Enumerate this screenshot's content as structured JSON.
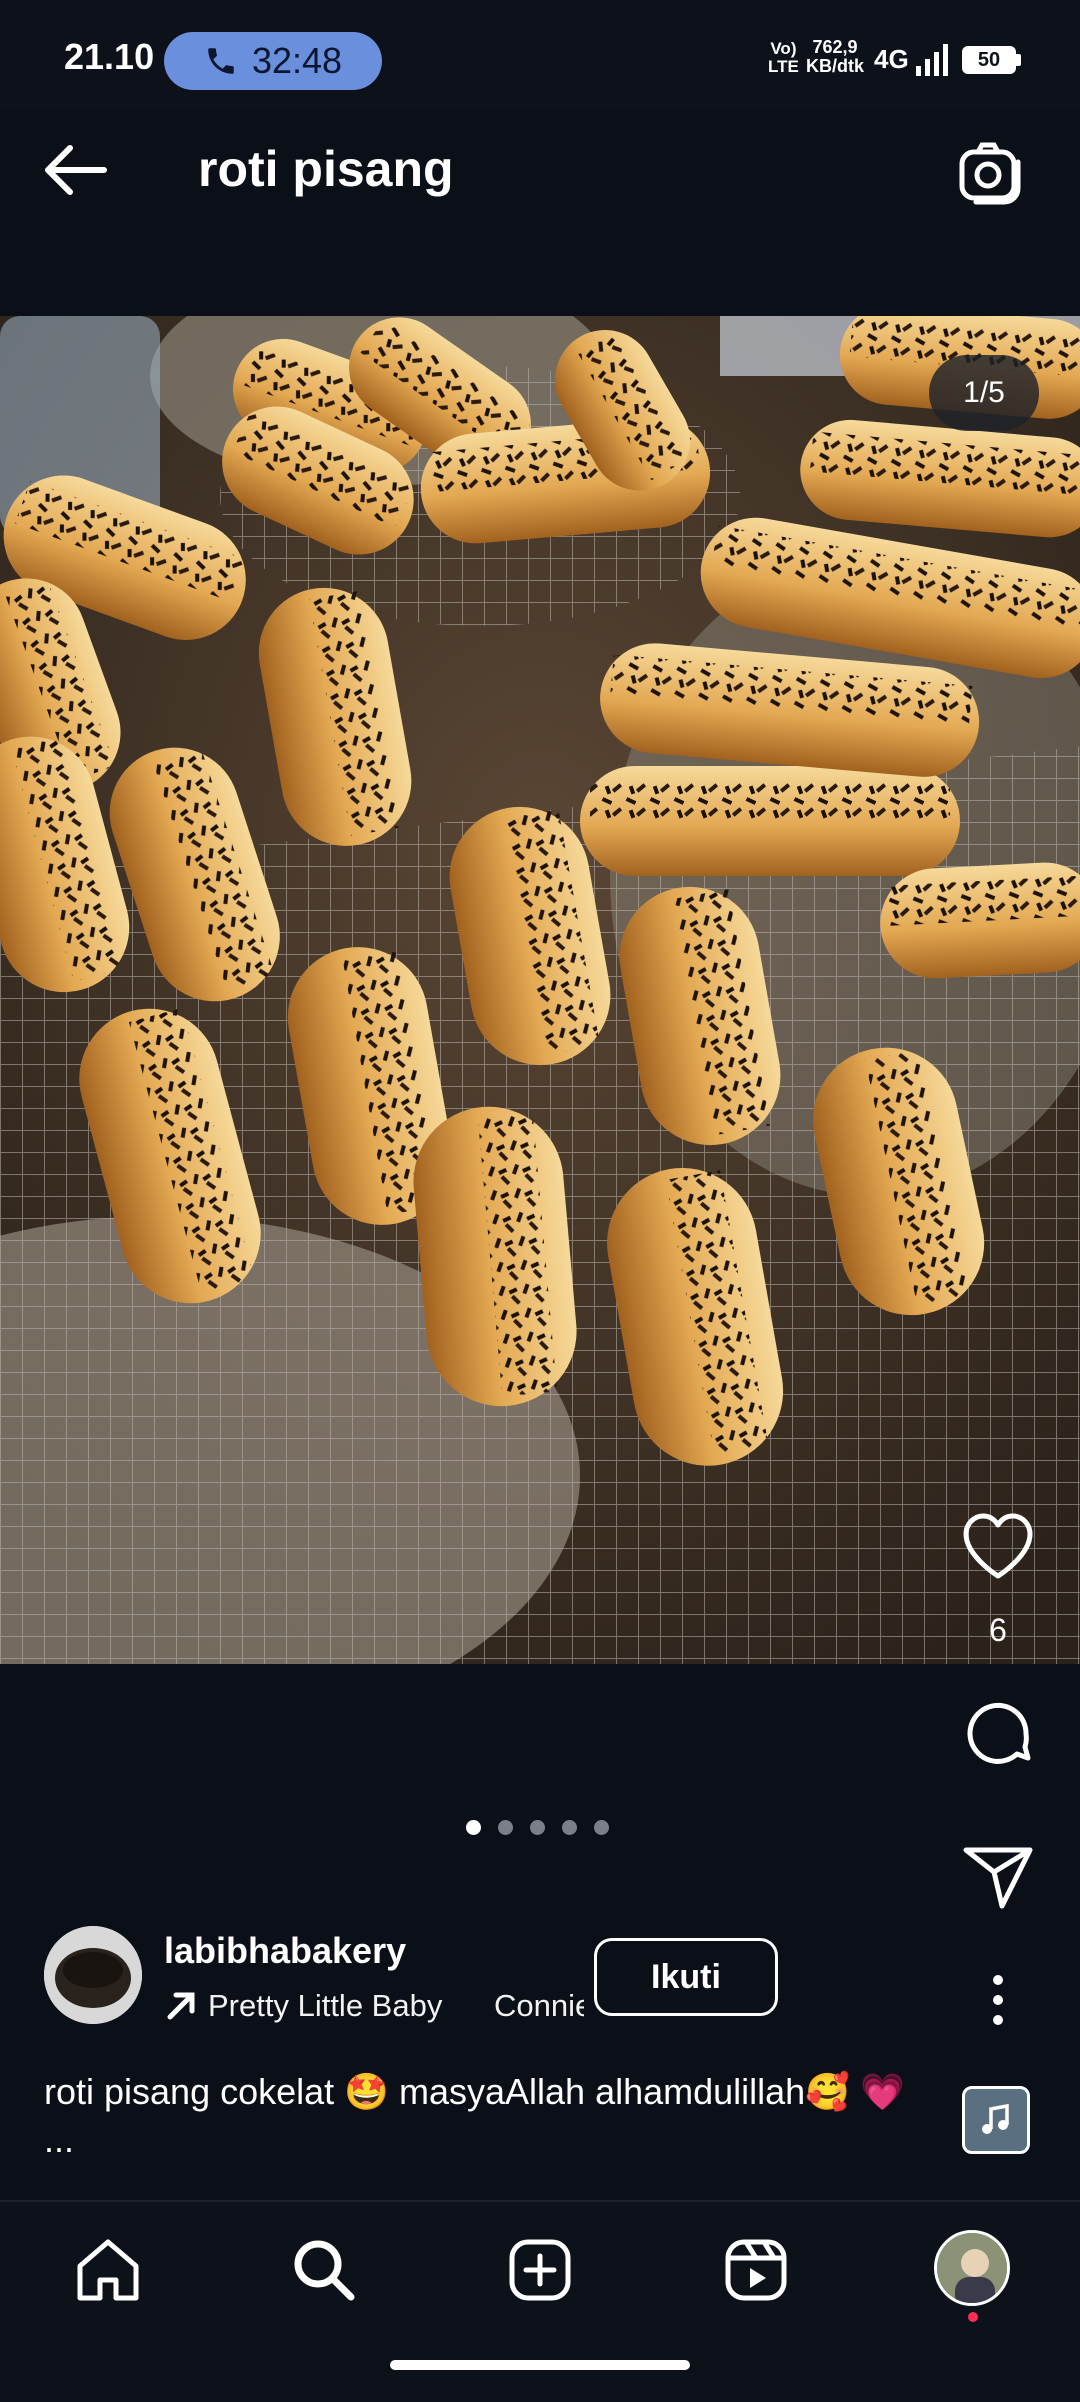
{
  "status_bar": {
    "time": "21.10",
    "call_timer": "32:48",
    "network_line1": "Vo)",
    "network_line2": "LTE",
    "speed_line1": "762,9",
    "speed_line2": "KB/dtk",
    "generation": "4G",
    "battery": "50"
  },
  "header": {
    "title": "roti pisang",
    "back_icon": "arrow-left-icon",
    "camera_icon": "camera-icon"
  },
  "post": {
    "image_counter": "1/5",
    "carousel": {
      "count": 5,
      "active": 0
    },
    "likes": "6",
    "username": "labibhabakery",
    "song": "Pretty Little Baby",
    "artist": "Connie Francis",
    "follow_label": "Ikuti",
    "caption": "roti pisang cokelat 🤩 masyaAllah  alhamdulillah🥰 💗 ..."
  },
  "colors": {
    "background": "#0b0f17",
    "call_pill": "#6a8fdc",
    "notification_dot": "#ff2d55"
  },
  "nav": {
    "items": [
      "home-icon",
      "search-icon",
      "create-icon",
      "reels-icon",
      "profile-avatar"
    ]
  }
}
